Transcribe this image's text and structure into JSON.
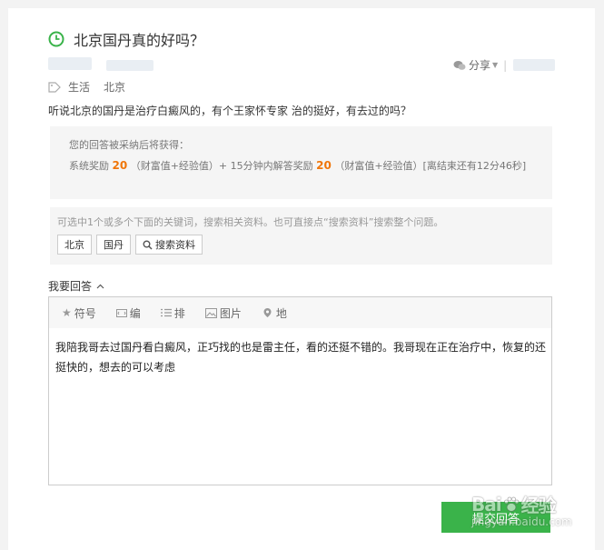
{
  "question": {
    "title": "北京国丹真的好吗？",
    "tags": [
      "生活",
      "北京"
    ],
    "body": "听说北京的国丹是治疗白癜风的，有个王家怀专家 治的挺好，有去过的吗？"
  },
  "share": {
    "label": "分享"
  },
  "reward": {
    "line1": "您的回答被采纳后将获得：",
    "system_label": "系统奖励",
    "system_value": "20",
    "system_unit": "（财富值+经验值）+ 15分钟内解答奖励",
    "fast_value": "20",
    "fast_unit": "（财富值+经验值）[离结束还有12分46秒]"
  },
  "keywords": {
    "hint": "可选中1个或多个下面的关键词，搜索相关资料。也可直接点“搜索资料”搜索整个问题。",
    "items": [
      "北京",
      "国丹"
    ],
    "search_label": "搜索资料"
  },
  "answer": {
    "heading": "我要回答",
    "toolbar": [
      "符号",
      "编",
      "排",
      "图片",
      "地"
    ],
    "text": "我陪我哥去过国丹看白癜风，正巧找的也是雷主任，看的还挺不错的。我哥现在正在治疗中，恢复的还挺快的，想去的可以考虑",
    "submit_label": "提交回答"
  },
  "watermark": {
    "brand": "Bai",
    "brand2": "经验",
    "url": "jingyan.baidu.com"
  },
  "colors": {
    "accent_green": "#3ab34a",
    "reward_orange": "#f0760a"
  }
}
